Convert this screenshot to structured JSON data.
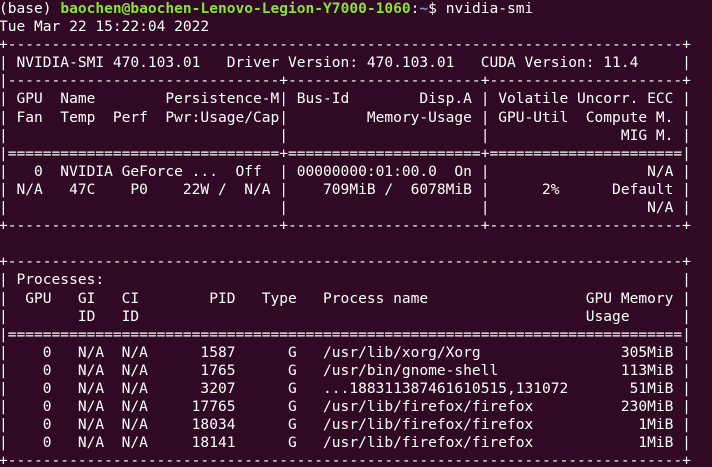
{
  "colors": {
    "background": "#300a24",
    "text": "#ffffff",
    "prompt_user": "#8ae234",
    "prompt_path": "#729fcf"
  },
  "prompt": {
    "env": "(base) ",
    "user_host": "baochen@baochen-Lenovo-Legion-Y7000-1060",
    "separator": ":",
    "path": "~",
    "symbol": "$ ",
    "command": "nvidia-smi"
  },
  "output_lines": [
    "Tue Mar 22 15:22:04 2022",
    "+-----------------------------------------------------------------------------+",
    "| NVIDIA-SMI 470.103.01   Driver Version: 470.103.01   CUDA Version: 11.4     |",
    "|-------------------------------+----------------------+----------------------+",
    "| GPU  Name        Persistence-M| Bus-Id        Disp.A | Volatile Uncorr. ECC |",
    "| Fan  Temp  Perf  Pwr:Usage/Cap|         Memory-Usage | GPU-Util  Compute M. |",
    "|                               |                      |               MIG M. |",
    "|===============================+======================+======================|",
    "|   0  NVIDIA GeForce ...  Off  | 00000000:01:00.0  On |                  N/A |",
    "| N/A   47C    P0    22W /  N/A |    709MiB /  6078MiB |      2%      Default |",
    "|                               |                      |                  N/A |",
    "+-------------------------------+----------------------+----------------------+",
    "",
    "+-----------------------------------------------------------------------------+",
    "| Processes:                                                                  |",
    "|  GPU   GI   CI        PID   Type   Process name                  GPU Memory |",
    "|        ID   ID                                                   Usage      |",
    "|=============================================================================|",
    "|    0   N/A  N/A      1587      G   /usr/lib/xorg/Xorg                305MiB |",
    "|    0   N/A  N/A      1765      G   /usr/bin/gnome-shell              113MiB |",
    "|    0   N/A  N/A      3207      G   ...188311387461610515,131072       51MiB |",
    "|    0   N/A  N/A     17765      G   /usr/lib/firefox/firefox          230MiB |",
    "|    0   N/A  N/A     18034      G   /usr/lib/firefox/firefox            1MiB |",
    "|    0   N/A  N/A     18141      G   /usr/lib/firefox/firefox            1MiB |",
    "+-----------------------------------------------------------------------------+"
  ]
}
